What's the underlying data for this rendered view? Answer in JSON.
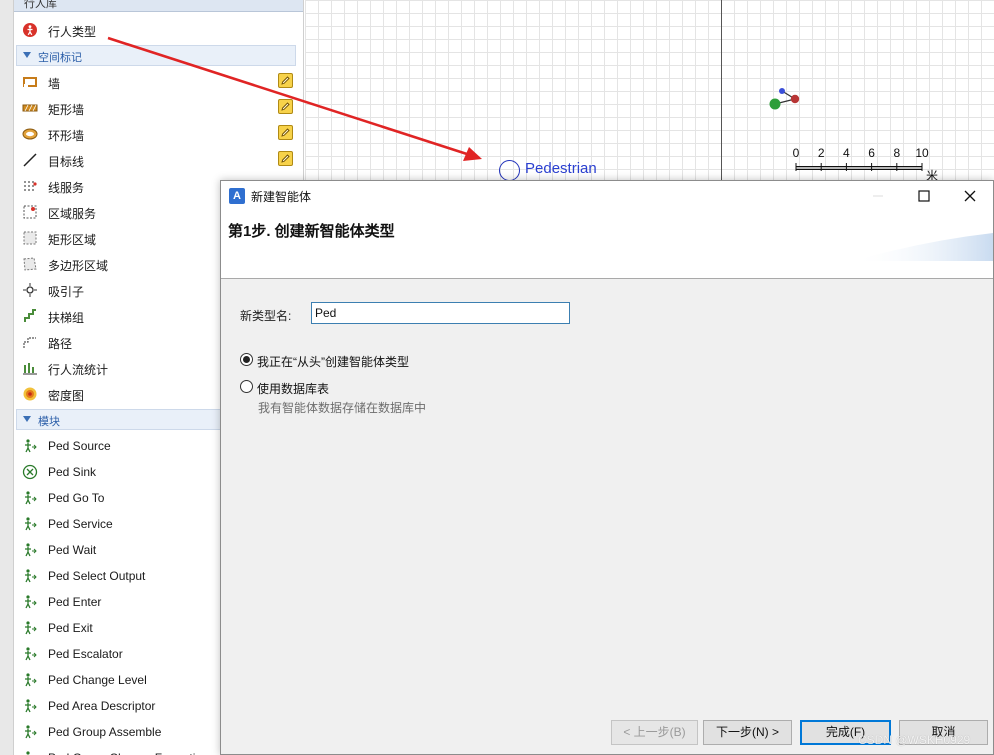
{
  "palette": {
    "top_title": "行人库",
    "ped_type": "行人类型",
    "section_space": "空间标记",
    "space_items": [
      {
        "label": "墙",
        "editable": true
      },
      {
        "label": "矩形墙",
        "editable": true
      },
      {
        "label": "环形墙",
        "editable": true
      },
      {
        "label": "目标线",
        "editable": true
      },
      {
        "label": "线服务",
        "editable": false
      },
      {
        "label": "区域服务",
        "editable": false
      },
      {
        "label": "矩形区域",
        "editable": false
      },
      {
        "label": "多边形区域",
        "editable": false
      },
      {
        "label": "吸引子",
        "editable": false
      },
      {
        "label": "扶梯组",
        "editable": false
      },
      {
        "label": "路径",
        "editable": false
      },
      {
        "label": "行人流统计",
        "editable": false
      },
      {
        "label": "密度图",
        "editable": false
      }
    ],
    "section_blocks": "模块",
    "block_items": [
      "Ped Source",
      "Ped Sink",
      "Ped Go To",
      "Ped Service",
      "Ped Wait",
      "Ped Select Output",
      "Ped Enter",
      "Ped Exit",
      "Ped Escalator",
      "Ped Change Level",
      "Ped Area Descriptor",
      "Ped Group Assemble",
      "Ped Group Change Formation"
    ]
  },
  "canvas": {
    "agent_label": "Pedestrian",
    "scale_ticks": [
      "0",
      "2",
      "4",
      "6",
      "8",
      "10"
    ],
    "scale_unit": "米"
  },
  "dialog": {
    "title": "新建智能体",
    "logo": "A",
    "step_title": "第1步. 创建新智能体类型",
    "type_name_label": "新类型名:",
    "type_name_value": "Ped",
    "radio_scratch": "我正在“从头”创建智能体类型",
    "radio_database": "使用数据库表",
    "database_hint": "我有智能体数据存储在数据库中",
    "selected_option": "scratch",
    "buttons": {
      "back": "< 上一步(B)",
      "next": "下一步(N) >",
      "finish": "完成(F)",
      "cancel": "取消"
    }
  },
  "watermark": "CSDN @WSKH0929",
  "colors": {
    "arrow": "#e02424",
    "dialog_bg": "#f0f0f0",
    "section_header_text": "#2b5ea8",
    "agent_label": "#2a3fd0",
    "default_button_border": "#0078d7"
  }
}
